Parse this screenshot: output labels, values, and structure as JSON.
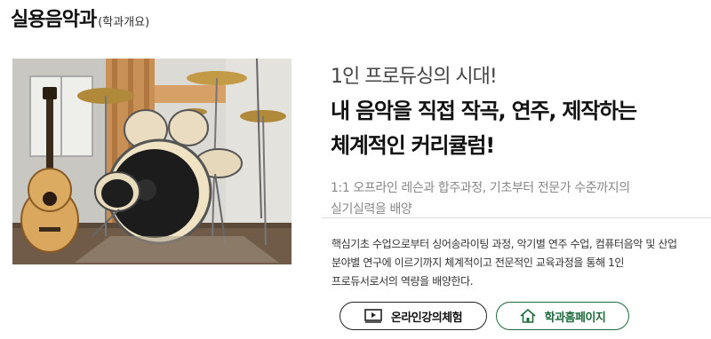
{
  "header": {
    "title": "실용음악과",
    "subtitle": "(학과개요)"
  },
  "hero": {
    "kicker": "1인 프로듀싱의 시대!",
    "headline_line1": "내 음악을 직접 작곡, 연주, 제작하는",
    "headline_line2": "체계적인 커리큘럼!",
    "sub_line1": "1:1 오프라인 레슨과 합주과정, 기초부터 전문가 수준까지의",
    "sub_line2": "실기실력을 배양"
  },
  "description": {
    "line1": "핵심기초 수업으로부터 싱어송라이팅 과정, 악기별 연주 수업, 컴퓨터음악 및 산업",
    "line2": "분야별 연구에 이르기까지 체계적이고 전문적인 교육과정을 통해 1인",
    "line3": "프로듀서로서의 역량을 배양한다."
  },
  "buttons": {
    "online_label": "온라인강의체험",
    "online_icon": "video-play-icon",
    "home_label": "학과홈페이지",
    "home_icon": "home-icon"
  },
  "colors": {
    "accent_green": "#1e6b3c",
    "dark": "#222222"
  }
}
